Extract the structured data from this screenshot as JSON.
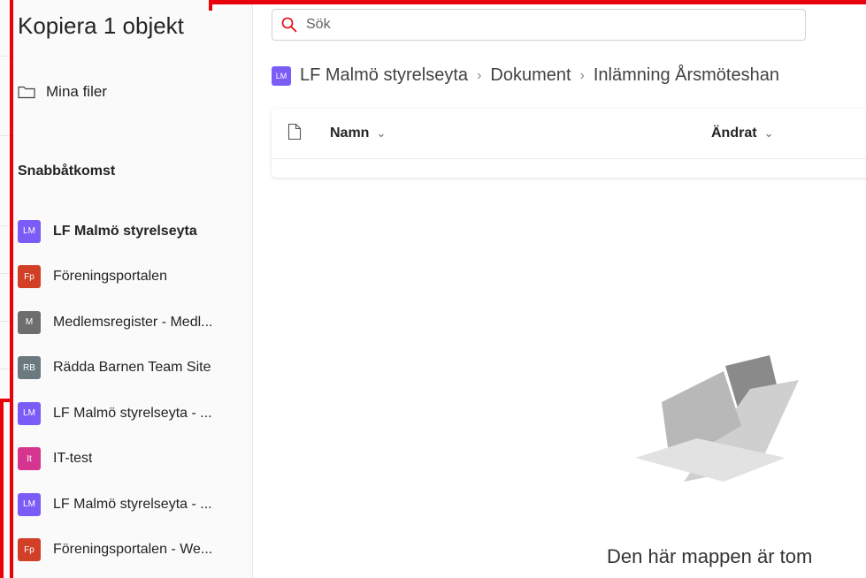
{
  "dialog": {
    "title": "Kopiera 1 objekt"
  },
  "nav": {
    "my_files": "Mina filer"
  },
  "quick_access": {
    "label": "Snabbåtkomst",
    "items": [
      {
        "badge": "LM",
        "color": "#7b5cf6",
        "label": "LF Malmö styrelseyta",
        "active": true
      },
      {
        "badge": "Fp",
        "color": "#d13f27",
        "label": "Föreningsportalen"
      },
      {
        "badge": "M",
        "color": "#6e6e6e",
        "label": "Medlemsregister - Medl..."
      },
      {
        "badge": "RB",
        "color": "#69797e",
        "label": "Rädda Barnen Team Site"
      },
      {
        "badge": "LM",
        "color": "#7b5cf6",
        "label": "LF Malmö styrelseyta - ..."
      },
      {
        "badge": "It",
        "color": "#d6358f",
        "label": "IT-test"
      },
      {
        "badge": "LM",
        "color": "#7b5cf6",
        "label": "LF Malmö styrelseyta - ..."
      },
      {
        "badge": "Fp",
        "color": "#d13f27",
        "label": "Föreningsportalen - We..."
      }
    ]
  },
  "search": {
    "placeholder": "Sök"
  },
  "breadcrumb": {
    "site_badge": "LM",
    "site": "LF Malmö styrelseyta",
    "sep": "›",
    "folder": "Dokument",
    "current": "Inlämning Årsmöteshan"
  },
  "table": {
    "col_name": "Namn",
    "col_changed": "Ändrat",
    "chevron": "⌄"
  },
  "empty": {
    "message": "Den här mappen är tom"
  },
  "colors": {
    "accent": "#7b5cf6",
    "annotation": "#e8000d"
  },
  "icons": {
    "search": "search-icon",
    "folder": "folder-icon",
    "file": "file-icon"
  }
}
